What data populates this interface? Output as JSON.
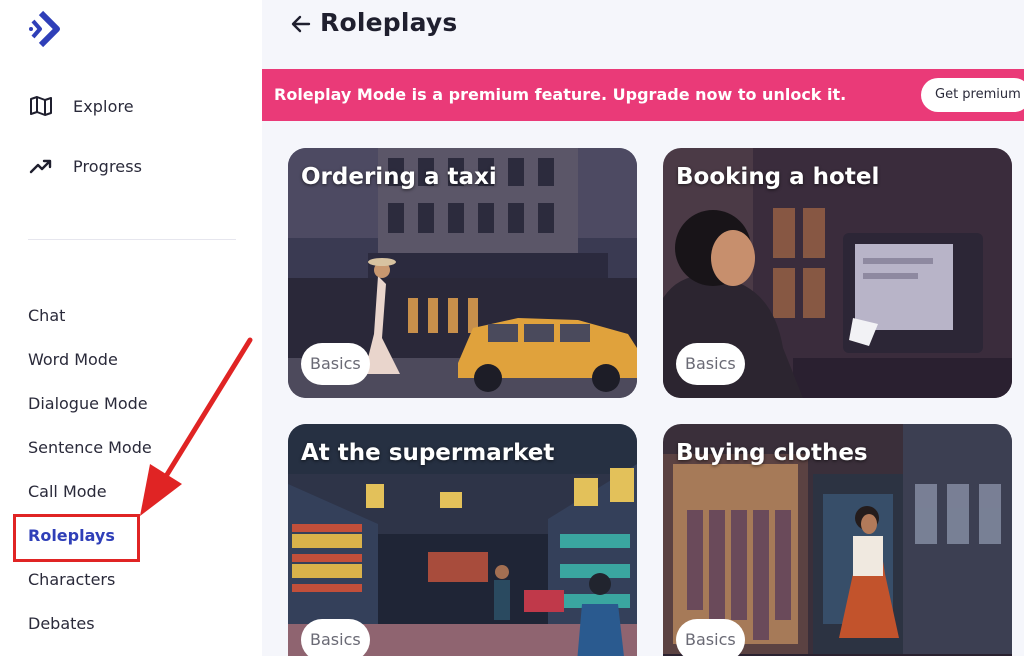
{
  "sidebar": {
    "primary_nav": [
      {
        "label": "Explore",
        "icon": "map-icon"
      },
      {
        "label": "Progress",
        "icon": "trending-up-icon"
      }
    ],
    "modes": [
      "Chat",
      "Word Mode",
      "Dialogue Mode",
      "Sentence Mode",
      "Call Mode",
      "Roleplays",
      "Characters",
      "Debates"
    ],
    "active_mode": "Roleplays"
  },
  "header": {
    "title": "Roleplays"
  },
  "banner": {
    "text": "Roleplay Mode is a premium feature. Upgrade now to unlock it.",
    "button_label": "Get premium"
  },
  "cards": [
    {
      "title": "Ordering a taxi",
      "badge": "Basics"
    },
    {
      "title": "Booking a hotel",
      "badge": "Basics"
    },
    {
      "title": "At the supermarket",
      "badge": "Basics"
    },
    {
      "title": "Buying clothes",
      "badge": "Basics"
    }
  ],
  "colors": {
    "accent": "#2f3fb8",
    "banner": "#ea3a78",
    "annotation": "#e02424"
  }
}
